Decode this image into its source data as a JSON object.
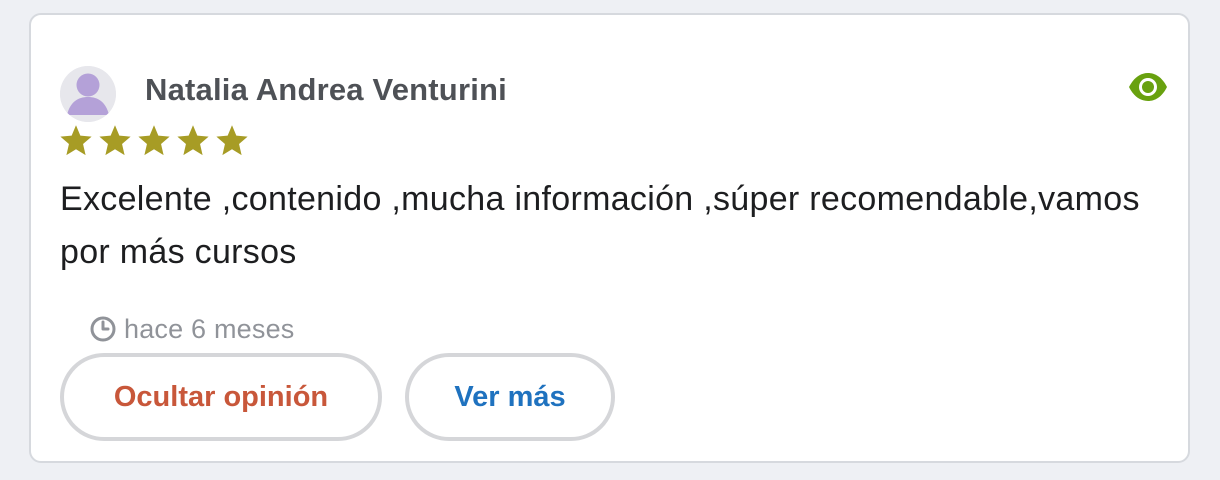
{
  "review": {
    "author": "Natalia Andrea Venturini",
    "rating": 5,
    "rating_max": 5,
    "text": "Excelente ,contenido ,mucha información ,súper recomendable,vamos por más cursos",
    "time": "hace 6 meses"
  },
  "actions": {
    "hide_label": "Ocultar opinión",
    "more_label": "Ver más"
  },
  "icons": {
    "avatar": "user-avatar-icon",
    "visibility": "eye-icon",
    "time": "clock-icon",
    "star": "star-icon"
  },
  "colors": {
    "star": "#a79c25",
    "eye": "#68a10f",
    "hide_button_text": "#c8573a",
    "more_button_text": "#1f72bf",
    "author": "#4e5156",
    "time": "#909399"
  }
}
